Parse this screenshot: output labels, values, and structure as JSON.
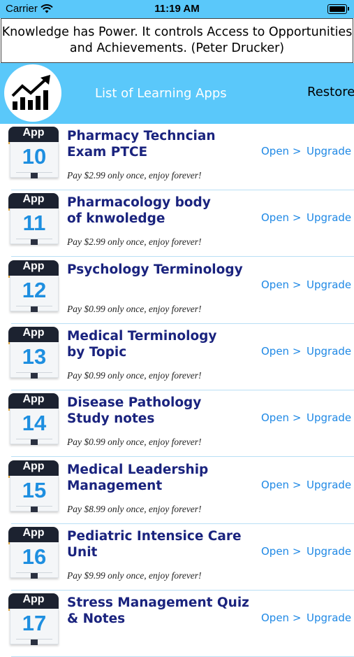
{
  "status_bar": {
    "carrier": "Carrier",
    "time": "11:19 AM"
  },
  "quote": "Knowledge has Power. It controls Access to Opportunities and Achievements. (Peter Drucker)",
  "header": {
    "title": "List of Learning Apps",
    "restore_label": "Restore"
  },
  "badge_label": "App",
  "apps": [
    {
      "number": "10",
      "name_line1": "Pharmacy Techncian",
      "name_line2": "Exam  PTCE",
      "open": "Open  >",
      "upgrade": "Upgrade >",
      "price": "Pay $2.99 only once, enjoy forever!"
    },
    {
      "number": "11",
      "name_line1": "Pharmacology body",
      "name_line2": "of knwoledge",
      "open": "Open  >",
      "upgrade": "Upgrade >",
      "price": "Pay $2.99 only once, enjoy forever!"
    },
    {
      "number": "12",
      "name_line1": "Psychology Terminology",
      "name_line2": "",
      "open": "Open  >",
      "upgrade": "Upgrade >",
      "price": "Pay $0.99 only once, enjoy forever!"
    },
    {
      "number": "13",
      "name_line1": "Medical Terminology",
      "name_line2": "by Topic",
      "open": "Open  >",
      "upgrade": "Upgrade >",
      "price": "Pay $0.99 only once, enjoy forever!"
    },
    {
      "number": "14",
      "name_line1": "Disease Pathology",
      "name_line2": "Study notes",
      "open": "Open  >",
      "upgrade": "Upgrade >",
      "price": "Pay $0.99 only once, enjoy forever!"
    },
    {
      "number": "15",
      "name_line1": "Medical Leadership",
      "name_line2": "Management",
      "open": "Open  >",
      "upgrade": "Upgrade >",
      "price": "Pay $8.99 only once, enjoy forever!"
    },
    {
      "number": "16",
      "name_line1": "Pediatric Intensice Care Unit",
      "name_line2": "",
      "open": "Open  >",
      "upgrade": "Upgrade >",
      "price": "Pay $9.99 only once, enjoy forever!"
    },
    {
      "number": "17",
      "name_line1": "Stress Management Quiz",
      "name_line2": "& Notes",
      "open": "Open  >",
      "upgrade": "Upgrade >",
      "price": ""
    }
  ],
  "colors": {
    "header_bg": "#5ac8fa",
    "app_name": "#1a237e",
    "link": "#1e88e5",
    "badge_number": "#1e8fe0"
  },
  "icons": {
    "logo": "growth-chart-icon",
    "wifi": "wifi-icon",
    "battery": "battery-icon"
  }
}
